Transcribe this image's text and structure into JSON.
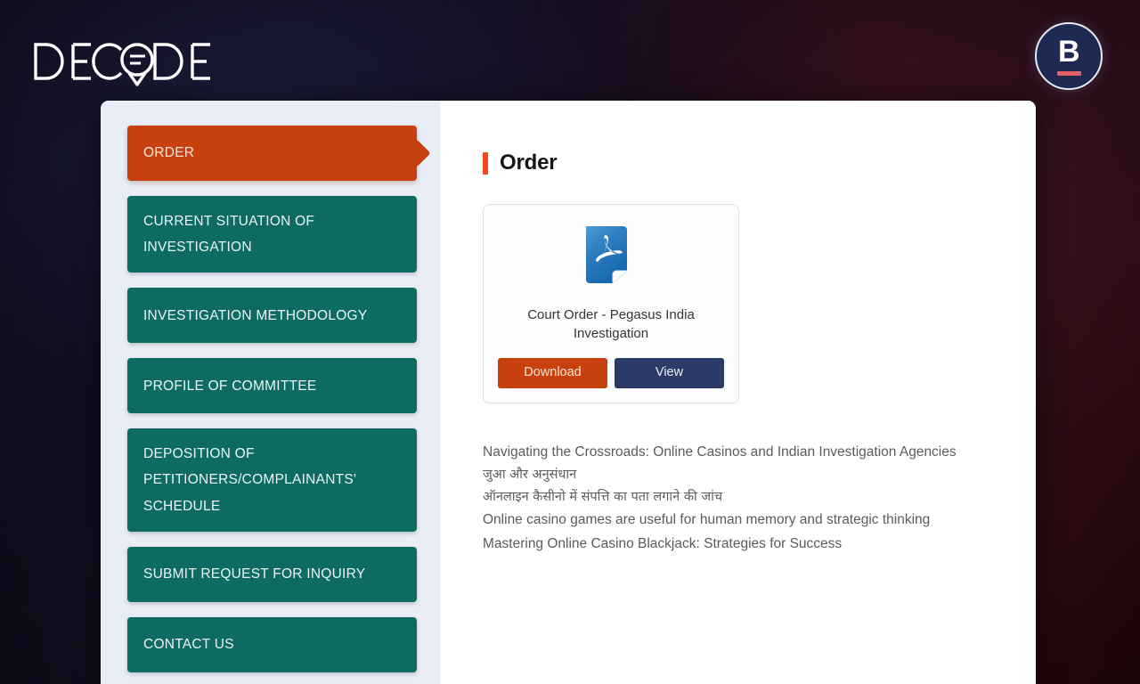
{
  "brand": {
    "wordmark": "DECODE",
    "roundel_letter": "B",
    "roundel_icon": "b-logo-roundel"
  },
  "colors": {
    "accent_orange": "#c8400d",
    "accent_teal": "#0e6b62",
    "accent_navy": "#2b3a66",
    "title_bar_red": "#f6461b",
    "sidebar_bg": "#e9edf5",
    "roundel_bar": "#e4616a"
  },
  "sidebar": {
    "items": [
      {
        "label": "ORDER",
        "active": true
      },
      {
        "label": "CURRENT SITUATION OF INVESTIGATION",
        "active": false
      },
      {
        "label": "INVESTIGATION METHODOLOGY",
        "active": false
      },
      {
        "label": "PROFILE OF COMMITTEE",
        "active": false
      },
      {
        "label": "DEPOSITION OF PETITIONERS/COMPLAINANTS' SCHEDULE",
        "active": false
      },
      {
        "label": "SUBMIT REQUEST FOR INQUIRY",
        "active": false
      },
      {
        "label": "CONTACT US",
        "active": false
      }
    ]
  },
  "main": {
    "title": "Order",
    "document_card": {
      "file_icon": "pdf-file-icon",
      "title": "Court Order - Pegasus India Investigation",
      "download_label": "Download",
      "view_label": "View"
    },
    "links": [
      {
        "text": "Navigating the Crossroads: Online Casinos and Indian Investigation Agencies",
        "script": "latin"
      },
      {
        "text": "जुआ और अनुसंधान",
        "script": "devanagari"
      },
      {
        "text": "ऑनलाइन कैसीनो में संपत्ति का पता लगाने की जांच",
        "script": "devanagari"
      },
      {
        "text": "Online casino games are useful for human memory and strategic thinking",
        "script": "latin"
      },
      {
        "text": "Mastering Online Casino Blackjack: Strategies for Success",
        "script": "latin"
      }
    ]
  }
}
